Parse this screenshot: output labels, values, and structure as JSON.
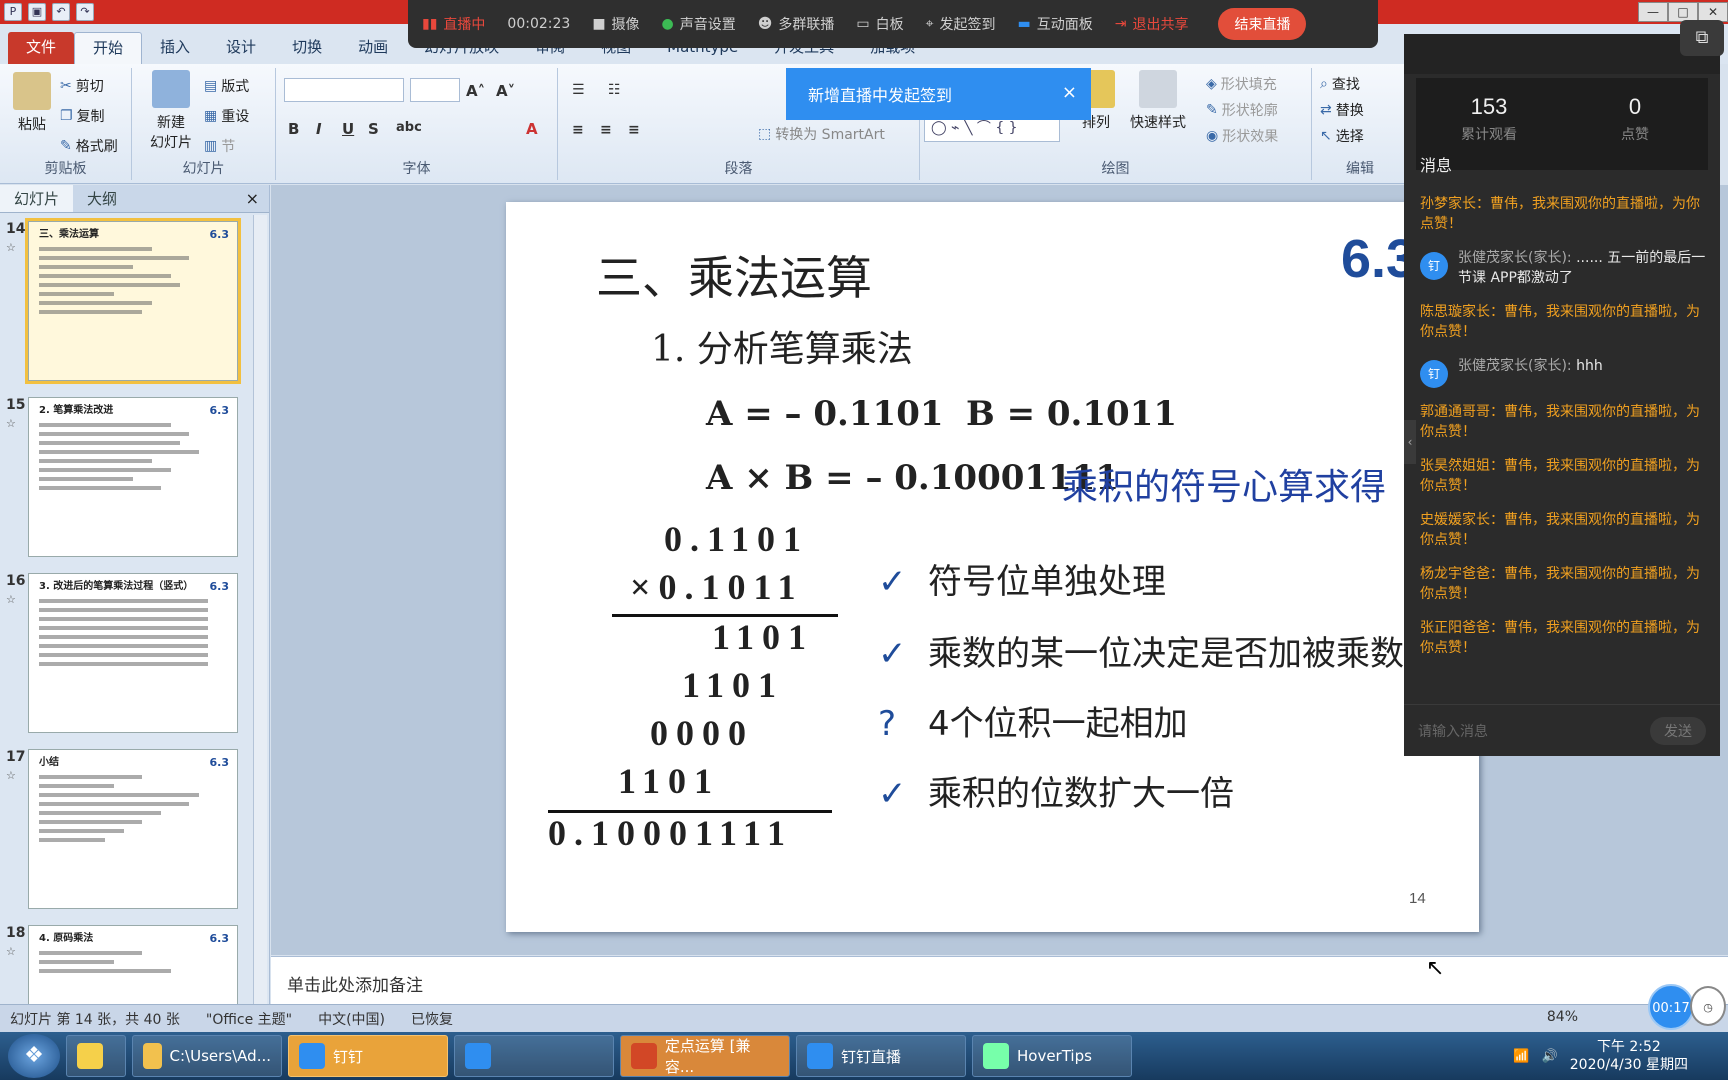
{
  "titlebar": {
    "window_controls": [
      "—",
      "□",
      "✕"
    ]
  },
  "live_toolbar": {
    "status": "直播中",
    "elapsed": "00:02:23",
    "camera": "摄像",
    "sound": "声音设置",
    "multi": "多群联播",
    "whiteboard": "白板",
    "checkin": "发起签到",
    "interact": "互动面板",
    "exit_share": "退出共享",
    "end_live": "结束直播"
  },
  "ribbon_tabs": [
    "文件",
    "开始",
    "插入",
    "设计",
    "切换",
    "动画",
    "幻灯片放映",
    "审阅",
    "视图",
    "Mathtype",
    "开发工具",
    "加载项"
  ],
  "ribbon": {
    "clipboard": {
      "paste": "粘贴",
      "cut": "剪切",
      "copy": "复制",
      "format_painter": "格式刷",
      "label": "剪贴板"
    },
    "slides": {
      "new_slide": "新建",
      "new_slide2": "幻灯片",
      "layout": "版式",
      "reset": "重设",
      "section": "节",
      "label": "幻灯片"
    },
    "font": {
      "label": "字体"
    },
    "paragraph": {
      "smartart": "转换为 SmartArt",
      "label": "段落"
    },
    "drawing": {
      "arrange": "排列",
      "quick_styles": "快速样式",
      "shape_fill": "形状填充",
      "shape_outline": "形状轮廓",
      "shape_effects": "形状效果",
      "label": "绘图"
    },
    "editing": {
      "find": "查找",
      "replace": "替换",
      "select": "选择",
      "label": "编辑"
    }
  },
  "notice": {
    "text": "新增直播中发起签到",
    "close": "×"
  },
  "panel_tabs": {
    "slides": "幻灯片",
    "outline": "大纲",
    "close": "×"
  },
  "thumbnails": [
    {
      "num": "14",
      "title": "三、乘法运算",
      "section": "6.3",
      "selected": true
    },
    {
      "num": "15",
      "title": "2. 笔算乘法改进",
      "section": "6.3",
      "selected": false
    },
    {
      "num": "16",
      "title": "3. 改进后的笔算乘法过程（竖式）",
      "section": "6.3",
      "selected": false
    },
    {
      "num": "17",
      "title": "小结",
      "section": "6.3",
      "selected": false
    },
    {
      "num": "18",
      "title": "4. 原码乘法",
      "section": "6.3",
      "selected": false
    }
  ],
  "slide": {
    "title": "三、乘法运算",
    "section_num": "6.3",
    "subtitle": "1. 分析笔算乘法",
    "eq_a": "A = – 0.1101",
    "eq_b": "B = 0.1011",
    "eq_ab": "A × B = – 0.10001111",
    "eq_note": "乘积的符号心算求得",
    "mul_rows": [
      "0.1101",
      "×0.1011",
      "1101",
      "1101",
      "0000",
      "1101",
      "0.10001111"
    ],
    "checks": [
      {
        "mark": "✓",
        "text": "符号位单独处理"
      },
      {
        "mark": "✓",
        "text": "乘数的某一位决定是否加被乘数"
      },
      {
        "mark": "?",
        "text": "4个位积一起相加"
      },
      {
        "mark": "✓",
        "text": "乘积的位数扩大一倍"
      }
    ],
    "page": "14"
  },
  "notes_placeholder": "单击此处添加备注",
  "statusbar": {
    "slide_info": "幻灯片 第 14 张，共 40 张",
    "theme": "\"Office 主题\"",
    "lang": "中文(中国)",
    "recovered": "已恢复",
    "zoom": "84%"
  },
  "taskbar": {
    "items": [
      "C:\\Users\\Ad...",
      "钉钉",
      "",
      "定点运算 [兼容...",
      "钉钉直播",
      "HoverTips"
    ],
    "time": "下午 2:52",
    "date": "2020/4/30 星期四"
  },
  "live_panel": {
    "watch_count": "153",
    "watch_label": "累计观看",
    "like_count": "0",
    "like_label": "点赞",
    "messages_title": "消息",
    "messages": [
      {
        "type": "system",
        "text": "孙梦家长：曹伟，我来围观你的直播啦，为你点赞！"
      },
      {
        "type": "user",
        "name": "张健茂家长(家长):",
        "text": "...... 五一前的最后一节课  APP都激动了"
      },
      {
        "type": "system",
        "text": "陈思璇家长：曹伟，我来围观你的直播啦，为你点赞！"
      },
      {
        "type": "user",
        "name": "张健茂家长(家长):",
        "text": "hhh"
      },
      {
        "type": "system",
        "text": "郭通通哥哥：曹伟，我来围观你的直播啦，为你点赞！"
      },
      {
        "type": "system",
        "text": "张昊然姐姐：曹伟，我来围观你的直播啦，为你点赞！"
      },
      {
        "type": "system",
        "text": "史媛媛家长：曹伟，我来围观你的直播啦，为你点赞！"
      },
      {
        "type": "system",
        "text": "杨龙宇爸爸：曹伟，我来围观你的直播啦，为你点赞！"
      },
      {
        "type": "system",
        "text": "张正阳爸爸：曹伟，我来围观你的直播啦，为你点赞！"
      }
    ],
    "input_placeholder": "请输入消息",
    "send": "发送"
  },
  "timer": "00:17",
  "colors": {
    "accent": "#2f8ef0",
    "live_red": "#e24e3a",
    "slide_blue": "#1f4c9a",
    "msg_orange": "#f0a020"
  }
}
